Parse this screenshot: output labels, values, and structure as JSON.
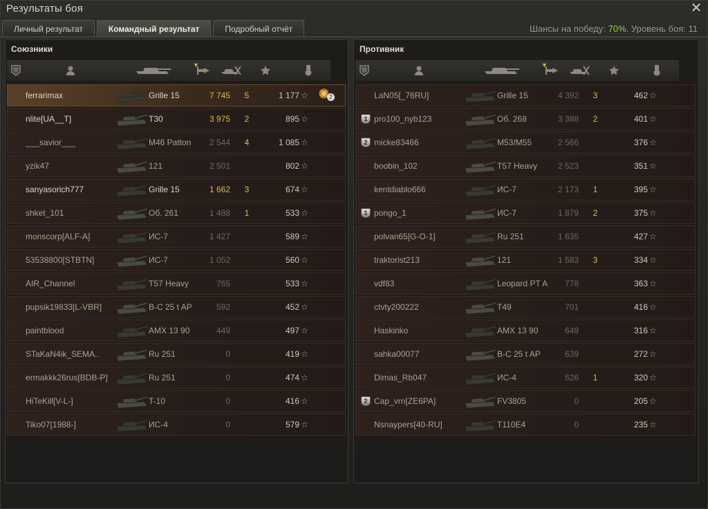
{
  "window": {
    "title": "Результаты боя",
    "close_icon": "close-icon"
  },
  "tabs": [
    {
      "label": "Личный результат"
    },
    {
      "label": "Командный результат"
    },
    {
      "label": "Подробный отчёт"
    }
  ],
  "chance": {
    "prefix": "Шансы на победу: ",
    "value": "70%",
    "level_text": ". Уровень боя: 11"
  },
  "allies": {
    "title": "Союзники",
    "rows": [
      {
        "name": "ferrarimax",
        "tank": "Grille 15",
        "damage": "7 745",
        "frags": "5",
        "xp": "1 177",
        "medal": "2",
        "me": true
      },
      {
        "name": "nlite[UA__T]",
        "tank": "T30",
        "damage": "3 975",
        "frags": "2",
        "xp": "895"
      },
      {
        "name": "___savior___",
        "tank": "M46 Patton",
        "damage": "2 544",
        "frags": "4",
        "xp": "1 085"
      },
      {
        "name": "yzik47",
        "tank": "121",
        "damage": "2 501",
        "frags": "",
        "xp": "802"
      },
      {
        "name": "sanyasorich777",
        "tank": "Grille 15",
        "damage": "1 662",
        "frags": "3",
        "xp": "674"
      },
      {
        "name": "shket_101",
        "tank": "Об. 261",
        "damage": "1 488",
        "frags": "1",
        "xp": "533"
      },
      {
        "name": "monscorp[ALF-A]",
        "tank": "ИС-7",
        "damage": "1 427",
        "frags": "",
        "xp": "589"
      },
      {
        "name": "53538800[STBTN]",
        "tank": "ИС-7",
        "damage": "1 052",
        "frags": "",
        "xp": "560"
      },
      {
        "name": "AIR_Channel",
        "tank": "T57 Heavy",
        "damage": "765",
        "frags": "",
        "xp": "533"
      },
      {
        "name": "pupsik19833[L-VBR]",
        "tank": "B-C 25 t AP",
        "damage": "592",
        "frags": "",
        "xp": "452"
      },
      {
        "name": "paintblood",
        "tank": "AMX 13 90",
        "damage": "449",
        "frags": "",
        "xp": "497"
      },
      {
        "name": "STaKaN4ik_SEMA..",
        "tank": "Ru 251",
        "damage": "0",
        "frags": "",
        "xp": "419"
      },
      {
        "name": "ermakkk26rus[BDB-P]",
        "tank": "Ru 251",
        "damage": "0",
        "frags": "",
        "xp": "474"
      },
      {
        "name": "HiTeKill[V-L-]",
        "tank": "T-10",
        "damage": "0",
        "frags": "",
        "xp": "416"
      },
      {
        "name": "Tiko07[1988-]",
        "tank": "ИС-4",
        "damage": "0",
        "frags": "",
        "xp": "579"
      }
    ]
  },
  "enemies": {
    "title": "Противник",
    "rows": [
      {
        "name": "LaN05[_76RU]",
        "tank": "Grille 15",
        "damage": "4 392",
        "frags": "3",
        "xp": "462"
      },
      {
        "rank": "1",
        "name": "pro100_nyb123",
        "tank": "Об. 268",
        "damage": "3 388",
        "frags": "2",
        "xp": "401"
      },
      {
        "rank": "2",
        "name": "micke83466",
        "tank": "M53/M55",
        "damage": "2 566",
        "frags": "",
        "xp": "376"
      },
      {
        "name": "boobin_102",
        "tank": "T57 Heavy",
        "damage": "2 523",
        "frags": "",
        "xp": "351"
      },
      {
        "name": "kentdiablo666",
        "tank": "ИС-7",
        "damage": "2 173",
        "frags": "1",
        "xp": "395"
      },
      {
        "rank": "1",
        "name": "pongo_1",
        "tank": "ИС-7",
        "damage": "1 879",
        "frags": "2",
        "xp": "375"
      },
      {
        "name": "polvan65[G-O-1]",
        "tank": "Ru 251",
        "damage": "1 635",
        "frags": "",
        "xp": "427"
      },
      {
        "name": "traktorist213",
        "tank": "121",
        "damage": "1 583",
        "frags": "3",
        "xp": "334"
      },
      {
        "name": "vdf83",
        "tank": "Leopard PT A",
        "damage": "778",
        "frags": "",
        "xp": "363"
      },
      {
        "name": "ctvty200222",
        "tank": "T49",
        "damage": "701",
        "frags": "",
        "xp": "416"
      },
      {
        "name": "Haskinko",
        "tank": "AMX 13 90",
        "damage": "649",
        "frags": "",
        "xp": "316"
      },
      {
        "name": "sahka00077",
        "tank": "B-C 25 t AP",
        "damage": "639",
        "frags": "",
        "xp": "272"
      },
      {
        "name": "Dimas_Rb047",
        "tank": "ИС-4",
        "damage": "526",
        "frags": "1",
        "xp": "320"
      },
      {
        "rank": "2",
        "name": "Cap_vrn[ZE6PA]",
        "tank": "FV3805",
        "damage": "0",
        "frags": "",
        "xp": "205"
      },
      {
        "name": "Nsnaypers[40-RU]",
        "tank": "T110E4",
        "damage": "0",
        "frags": "",
        "xp": "235"
      }
    ]
  },
  "colors": {
    "win_chance": "#8cd43c",
    "frags": "#e0b84a",
    "highlight_row": "#5a4028"
  },
  "icons": {
    "columns": [
      "squad-icon",
      "player-icon",
      "tank-icon",
      "damage-icon",
      "frags-icon",
      "xp-star-icon",
      "medal-icon"
    ],
    "star": "☆"
  }
}
